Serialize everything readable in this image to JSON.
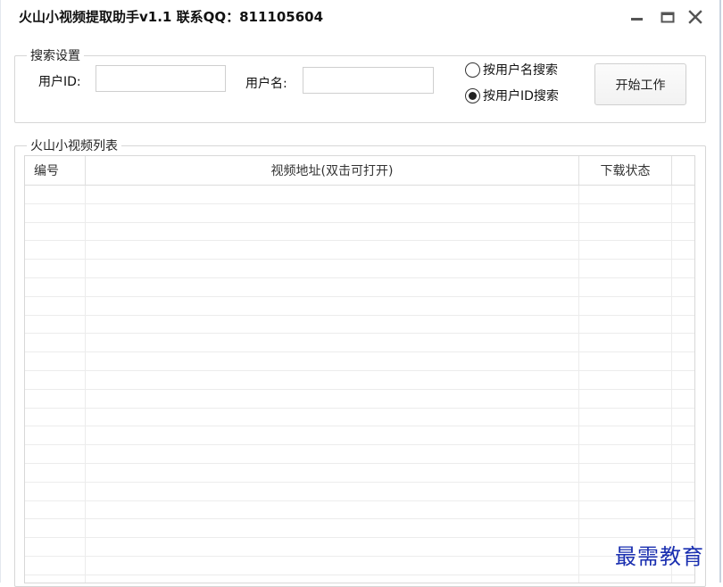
{
  "window": {
    "title": "火山小视频提取助手v1.1   联系QQ：811105604",
    "controls": [
      "minimize-icon",
      "maximize-icon",
      "close-icon"
    ]
  },
  "search_settings": {
    "legend": "搜索设置",
    "user_id_label": "用户ID:",
    "user_id_value": "",
    "username_label": "用户名:",
    "username_value": "",
    "radio_by_username": "按用户名搜索",
    "radio_by_userid": "按用户ID搜索",
    "selected_radio": "by_userid",
    "start_button": "开始工作"
  },
  "video_list": {
    "legend": "火山小视频列表",
    "columns": [
      "编号",
      "视频地址(双击可打开)",
      "下载状态"
    ],
    "rows": []
  },
  "watermark": "最需教育"
}
